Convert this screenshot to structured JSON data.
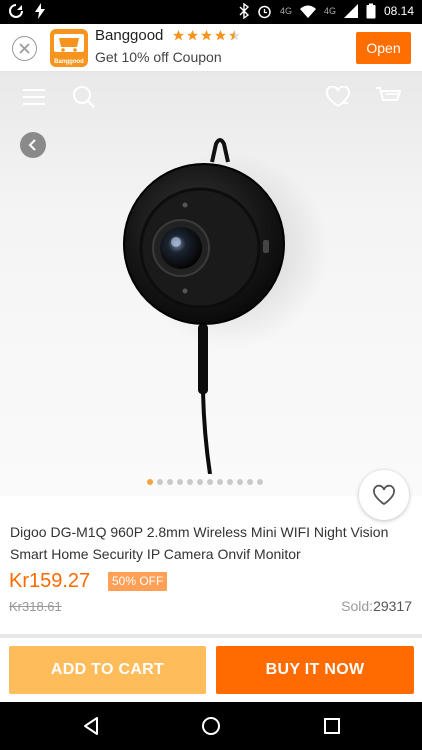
{
  "status_bar": {
    "time": "08.14",
    "network_label": "4G",
    "signal_label": "4G"
  },
  "app_banner": {
    "app_name": "Banggood",
    "logo_text": "Banggood",
    "rating_stars": 4.5,
    "coupon_text": "Get 10% off Coupon",
    "open_label": "Open"
  },
  "gallery": {
    "image_count": 12,
    "active_index": 0
  },
  "product": {
    "title": "Digoo DG-M1Q 960P 2.8mm Wireless Mini WIFI Night Vision Smart Home Security IP Camera Onvif Monitor",
    "price": "Kr159.27",
    "discount": "50% OFF",
    "old_price": "Kr318.61",
    "sold_label": "Sold:",
    "sold_count": "29317"
  },
  "actions": {
    "add_to_cart": "ADD TO CART",
    "buy_now": "BUY IT NOW"
  },
  "colors": {
    "accent": "#ff6b00",
    "add_to_cart_bg": "#ffbc5a",
    "price": "#ff6a00",
    "badge": "#ffa056",
    "star": "#f7941d"
  }
}
